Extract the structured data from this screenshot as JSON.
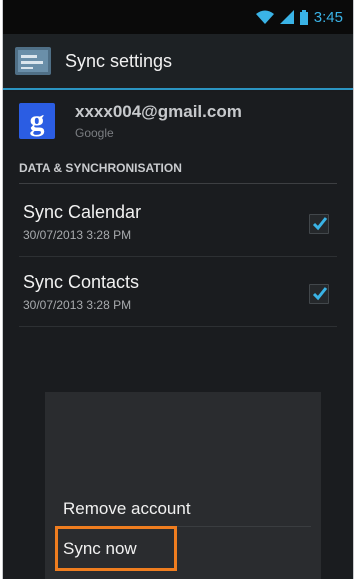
{
  "status_bar": {
    "time": "3:45"
  },
  "action_bar": {
    "title": "Sync settings",
    "icon": "sync-settings-icon"
  },
  "account": {
    "email": "xxxx004@gmail.com",
    "type": "Google",
    "logo_letter": "g"
  },
  "section": {
    "header": "DATA & SYNCHRONISATION"
  },
  "sync_items": [
    {
      "title": "Sync Calendar",
      "date": "30/07/2013 3:28 PM",
      "checked": true
    },
    {
      "title": "Sync Contacts",
      "date": "30/07/2013 3:28 PM",
      "checked": true
    }
  ],
  "menu": {
    "items": [
      {
        "label": "Remove account"
      },
      {
        "label": "Sync now"
      }
    ],
    "highlight_color": "#ef7d1f"
  },
  "colors": {
    "accent": "#3ab3e6",
    "background": "#1a1c1f",
    "google_blue": "#2b5de3"
  }
}
